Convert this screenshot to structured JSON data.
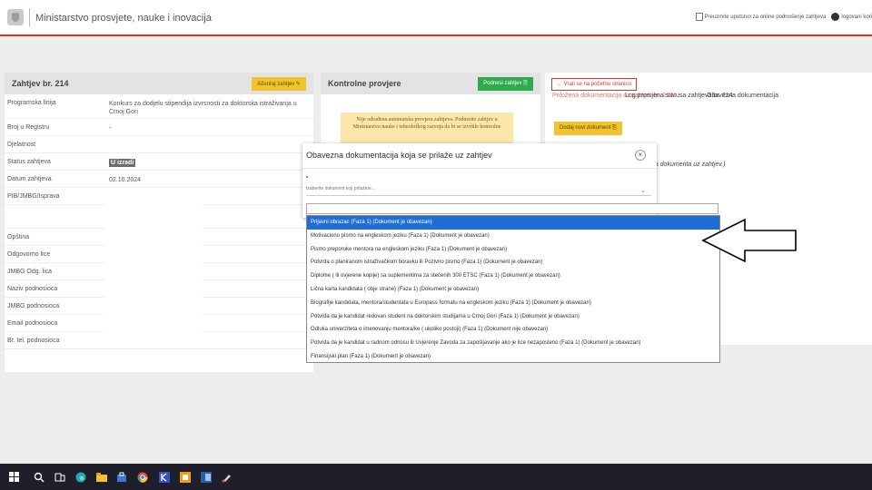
{
  "header": {
    "ministry": "Ministarstvo prosvjete, nauke i inovacija",
    "manual_link": "Preuzmite uputstvo za online podnošenje zahtjeva",
    "user_link": "logovani kori"
  },
  "left": {
    "title": "Zahtjev br. 214",
    "update_button": "Ažuriraj zahtjev",
    "rows": [
      {
        "label": "Programska linija",
        "value": "Konkurs za dodjelu stipendija izvrsnosti za doktorska istraživanja u Crnoj Gori"
      },
      {
        "label": "Broj u Registru",
        "value": "-"
      },
      {
        "label": "Djelatnost",
        "value": ""
      },
      {
        "label": "Status zahtjeva",
        "value": "U izradi"
      },
      {
        "label": "Datum zahtjeva",
        "value": "02.10.2024"
      },
      {
        "label": "PIB/JMBG/Isprava",
        "value": ""
      },
      {
        "label": "",
        "value": ""
      },
      {
        "label": "Opština",
        "value": ""
      },
      {
        "label": "Odgovorno lice",
        "value": ""
      },
      {
        "label": "JMBG Odg. lica",
        "value": ""
      },
      {
        "label": "Naziv podnosioca",
        "value": ""
      },
      {
        "label": "JMBG podnosioca",
        "value": ""
      },
      {
        "label": "Email podnosioca",
        "value": ""
      },
      {
        "label": "Br. tel. podnosioca",
        "value": ""
      }
    ]
  },
  "middle": {
    "title": "Kontrolne provjere",
    "submit_button": "Podnesi zahtjev",
    "warning": "Nije odrađena automatska provjera zahtjeva. Podnesite zahtjev u Ministarstvo nauke i tehnološkog razvoja da bi se izvršile kontrolne"
  },
  "right": {
    "back_button": "Vrati se na početnu stranicu",
    "tab_attached": "Priložena dokumentacija uz zahtjev br. 214",
    "tab_log": "Log promjena statusa zahtjeva br. 214",
    "tab_required": "Obavezna dokumentacija",
    "add_document_button": "Dodaj novi dokument",
    "empty_note": "ma dokumenta uz zahtjev.)"
  },
  "modal": {
    "title": "Obavezna dokumentacija koja se prilaže uz zahtjev",
    "close": "×",
    "select_placeholder": "Izaberite dokument koji prilažete..."
  },
  "dropdown": {
    "items": [
      "Prijavni obrazac (Faza 1) (Dokument je obavezan)",
      "Motivaciono pismo na engleskom jeziku (Faza 1) (Dokument je obavezan)",
      "Pismo preporuke mentora na engleskom jeziku (Faza 1) (Dokument je obavezan)",
      "Potvrda o planiranom istraživačkom boravku ili Pozivno pismo (Faza 1) (Dokument je obavezan)",
      "Diplome ( ili ovjerene kopije) sa suplementima za stečenih 300 ETSC (Faza 1) (Dokument je obavezan)",
      "Lična karta kandidata ( obje strane) (Faza 1) (Dokument je obavezan)",
      "Biografije kandidata, mentora/studentata u Europass formatu na engleskom jeziku (Faza 1) (Dokument je obavezan)",
      "Potvrda da je kandidat redovan student na doktorskim studijama u Crnoj Gori (Faza 1) (Dokument je obavezan)",
      "Odluka univerziteta o imenovanju mentora/ke ( ukoliko postoji) (Faza 1) (Dokument nije obavezan)",
      "Potvrda da je kandidat u radnom odnosu ili Uvjerenje Zavoda za zapošljavanje ako je lice nezaposleno (Faza 1) (Dokument je obavezan)",
      "Finansijski plan (Faza 1) (Dokument je obavezan)"
    ],
    "selected_index": 0
  },
  "colors": {
    "accent_red": "#d9362b",
    "button_yellow": "#f2c330",
    "button_green": "#2faa4e",
    "selected_blue": "#1e6ed6"
  }
}
